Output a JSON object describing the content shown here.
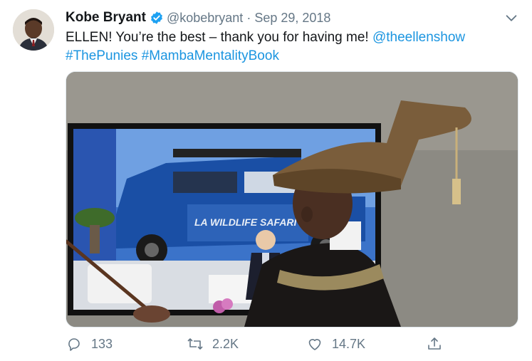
{
  "tweet": {
    "author_name": "Kobe Bryant",
    "handle": "@kobebryant",
    "separator": "·",
    "date": "Sep 29, 2018",
    "text_main": "ELLEN! You’re the best – thank you for having me! ",
    "mention": "@theellenshow",
    "hashtag_1": "#ThePunies",
    "hashtag_2": "#MambaMentalityBook",
    "media": {
      "screen_text": "LA WILDLIFE SAFARI"
    }
  },
  "actions": {
    "replies": "133",
    "retweets": "2.2K",
    "likes": "14.7K"
  },
  "colors": {
    "link": "#1b95e0",
    "verified": "#1da1f2",
    "muted": "#657786"
  },
  "icons": [
    "verified-badge-icon",
    "chevron-down-icon",
    "reply-icon",
    "retweet-icon",
    "like-icon",
    "share-icon"
  ]
}
